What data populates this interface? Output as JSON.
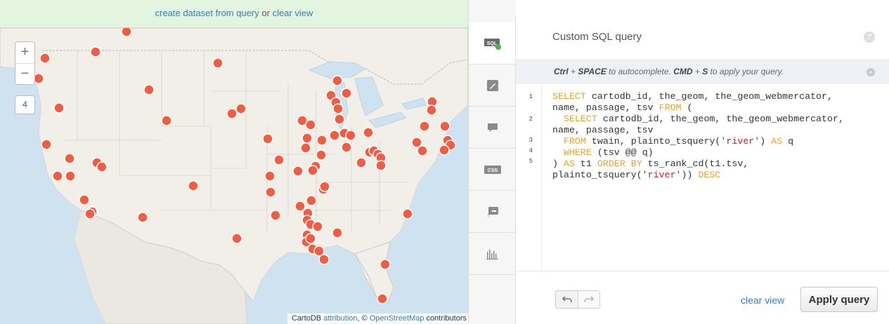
{
  "notice": {
    "create_link": "create dataset from query",
    "or_text": " or ",
    "clear_link": "clear view"
  },
  "map": {
    "zoom_in": "+",
    "zoom_out": "−",
    "zoom_level": "4",
    "marker_color": "#f25c42",
    "attribution": {
      "prefix": "CartoDB ",
      "attribution_link": "attribution",
      "sep": ", © ",
      "osm_link": "OpenStreetMap",
      "suffix": " contributors"
    }
  },
  "toolbar": {
    "items": [
      {
        "name": "sql",
        "icon": "sql-icon",
        "label": "SQL"
      },
      {
        "name": "wizard",
        "icon": "brush-icon"
      },
      {
        "name": "infowindow",
        "icon": "speech-bubble-icon"
      },
      {
        "name": "css",
        "icon": "css-icon",
        "label": "CSS"
      },
      {
        "name": "legends",
        "icon": "legend-icon"
      },
      {
        "name": "filters",
        "icon": "histogram-icon"
      }
    ]
  },
  "panel": {
    "title": "Custom SQL query",
    "help_icon": "?",
    "hint": {
      "k1": "Ctrl",
      "p1": " + ",
      "k2": "SPACE",
      "t1": " to autocomplete. ",
      "k3": "CMD",
      "p2": " + ",
      "k4": "S",
      "t2": " to apply your query."
    },
    "hint_close": "×",
    "line_numbers": [
      "1",
      "2",
      "3",
      "4",
      "5"
    ],
    "clear_view": "clear view",
    "apply_button": "Apply query"
  }
}
